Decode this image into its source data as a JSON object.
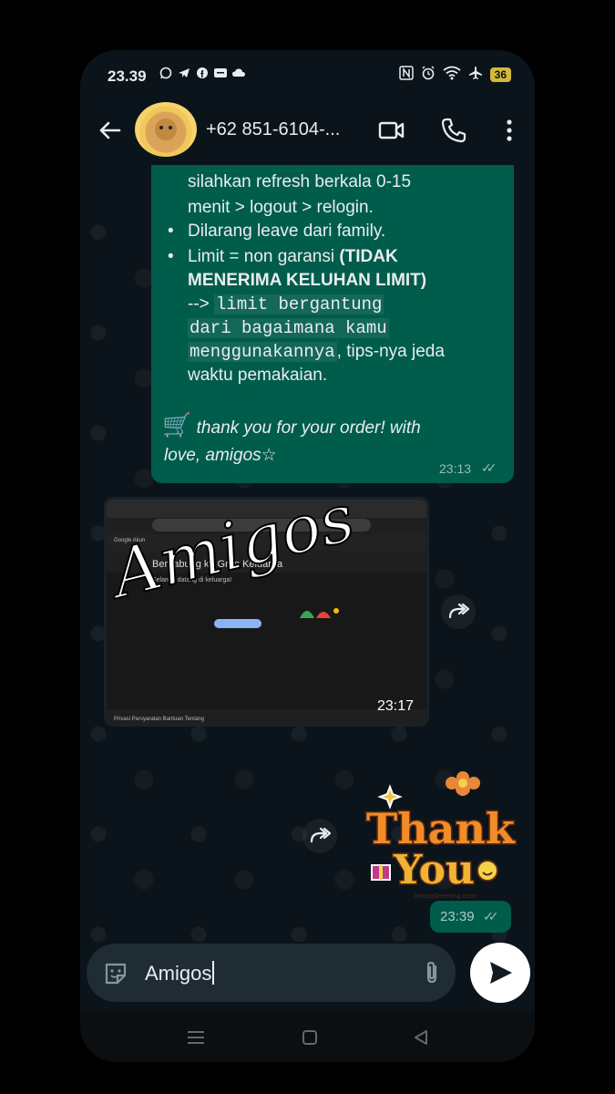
{
  "status_bar": {
    "time": "23.39",
    "battery": "36",
    "app_icons": [
      "whatsapp-icon",
      "telegram-icon",
      "facebook-icon",
      "notification-box-icon",
      "cloud-icon"
    ],
    "system_icons": [
      "nfc-icon",
      "alarm-icon",
      "wifi-icon",
      "airplane-icon",
      "battery-icon"
    ]
  },
  "header": {
    "contact_name": "+62 851-6104-..."
  },
  "message_out": {
    "line1": "silahkan refresh berkala 0-15",
    "line2": "menit > logout > relogin.",
    "bullet1": "Dilarang leave dari family.",
    "bullet2_a": "Limit = non garansi ",
    "bullet2_b": "(TIDAK",
    "bullet2_c": "MENERIMA KELUHAN LIMIT)",
    "arrow": "-->",
    "mono1": "limit bergantung",
    "mono2": "dari bagaimana kamu",
    "mono3": "menggunakannya",
    "tail3": ", tips-nya jeda",
    "line_last": "waktu pemakaian.",
    "cart": "🛒",
    "thanks_1": " thank you for your order! with",
    "thanks_2": "love, amigos",
    "star": "☆",
    "time": "23:13",
    "ticks": "✓✓"
  },
  "image_message": {
    "overlay_text": "Amigos",
    "time": "23:17",
    "screenshot": {
      "title": "Bergabung ke Grup Keluarga",
      "google_label": "Google Akun",
      "welcome": "Selamat datang di keluarga!",
      "footer": "Privasi   Persyaratan   Bantuan   Tentang"
    }
  },
  "sticker": {
    "word1": "Thank",
    "word2": "You",
    "credit": "GroupGreeting.com"
  },
  "sticker_time": "23:39",
  "composer": {
    "text": "Amigos"
  },
  "colors": {
    "bg": "#0b141a",
    "bubble_out": "#005c4b",
    "composer": "#1f2c33",
    "battery": "#d4b93a"
  }
}
